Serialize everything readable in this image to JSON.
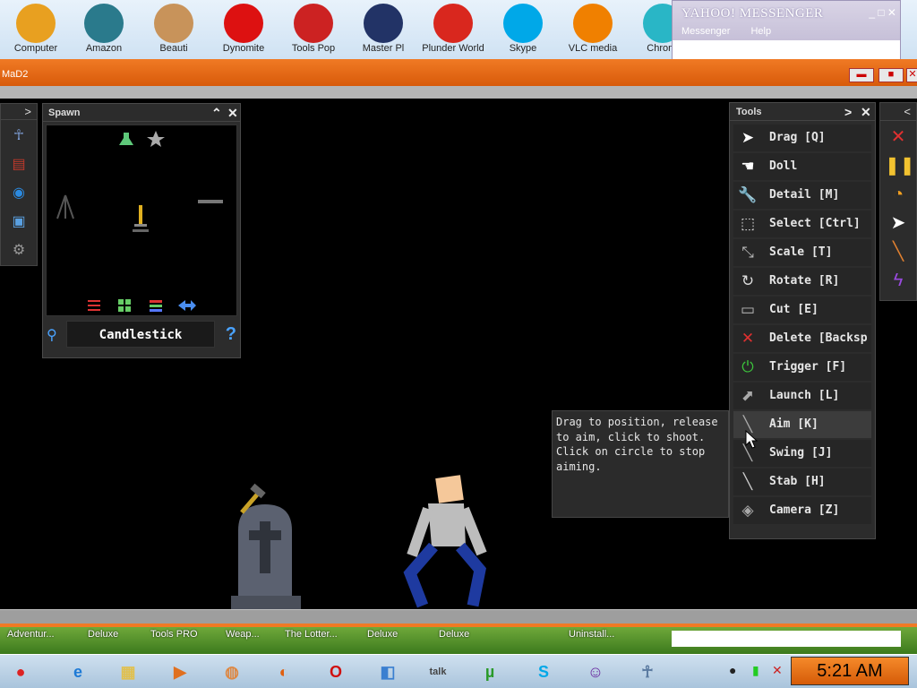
{
  "desktop": {
    "icons": [
      {
        "label": "Computer",
        "icon": "computer-icon",
        "color": "#e8a020"
      },
      {
        "label": "Amazon",
        "icon": "amazon-compass-icon",
        "color": "#2a7a8c"
      },
      {
        "label": "Beauti",
        "icon": "beauty-face-icon",
        "color": "#c8935a"
      },
      {
        "label": "Dynomite",
        "icon": "dynomite-ball-icon",
        "color": "#d11"
      },
      {
        "label": "Tools Pop",
        "icon": "tools-pop-bird-icon",
        "color": "#c22"
      },
      {
        "label": "Master Pl",
        "icon": "master-pl-shield-icon",
        "color": "#223366"
      },
      {
        "label": "Plunder World",
        "icon": "plunder-p-icon",
        "color": "#d9271e"
      },
      {
        "label": "Skype",
        "icon": "skype-icon",
        "color": "#00a8e8"
      },
      {
        "label": "VLC media",
        "icon": "vlc-cone-icon",
        "color": "#f08000"
      },
      {
        "label": "Chromi",
        "icon": "chromium-icon",
        "color": "#29b6c6"
      }
    ]
  },
  "yahoo": {
    "title": "YAHOO! MESSENGER",
    "menu": [
      "Messenger",
      "Help"
    ],
    "controls": "_ □ ✕"
  },
  "app": {
    "title": "MaD2",
    "minimize": "▬",
    "maximize": "■",
    "close": "✕"
  },
  "left_bar": {
    "expand": ">",
    "items": [
      {
        "icon": "ragdoll-icon",
        "glyph": "☥",
        "color": "#7fa0d8"
      },
      {
        "icon": "book-icon",
        "glyph": "▤",
        "color": "#c0392b"
      },
      {
        "icon": "globe-icon",
        "glyph": "◉",
        "color": "#2b8ae0"
      },
      {
        "icon": "save-disk-icon",
        "glyph": "▣",
        "color": "#5aa0e0"
      },
      {
        "icon": "settings-gear-icon",
        "glyph": "⚙",
        "color": "#999"
      }
    ]
  },
  "spawn": {
    "title": "Spawn",
    "collapse": "⌃",
    "close": "✕",
    "search_value": "Candlestick",
    "help": "?"
  },
  "tools": {
    "title": "Tools",
    "expand": ">",
    "close": "✕",
    "items": [
      {
        "label": "Drag [Q]",
        "icon": "drag-cursor-icon",
        "glyph": "➤",
        "color": "#fff"
      },
      {
        "label": "Doll",
        "icon": "doll-hand-icon",
        "glyph": "☚",
        "color": "#fff"
      },
      {
        "label": "Detail [M]",
        "icon": "wrench-icon",
        "glyph": "🔧",
        "color": "#aaa"
      },
      {
        "label": "Select [Ctrl]",
        "icon": "select-box-icon",
        "glyph": "⬚",
        "color": "#ddd"
      },
      {
        "label": "Scale [T]",
        "icon": "scale-icon",
        "glyph": "⤡",
        "color": "#bbb"
      },
      {
        "label": "Rotate [R]",
        "icon": "rotate-icon",
        "glyph": "↻",
        "color": "#ddd"
      },
      {
        "label": "Cut [E]",
        "icon": "cut-icon",
        "glyph": "▭",
        "color": "#bbb"
      },
      {
        "label": "Delete [Backsp",
        "icon": "delete-x-icon",
        "glyph": "✕",
        "color": "#e03030"
      },
      {
        "label": "Trigger [F]",
        "icon": "power-icon",
        "glyph": "⏻",
        "color": "#3cc43c"
      },
      {
        "label": "Launch [L]",
        "icon": "launch-icon",
        "glyph": "⬈",
        "color": "#aaa"
      },
      {
        "label": "Aim [K]",
        "icon": "aim-gun-icon",
        "glyph": "╲",
        "color": "#aaa"
      },
      {
        "label": "Swing [J]",
        "icon": "swing-hammer-icon",
        "glyph": "╲",
        "color": "#aaa"
      },
      {
        "label": "Stab [H]",
        "icon": "stab-knife-icon",
        "glyph": "╲",
        "color": "#ccc"
      },
      {
        "label": "Camera [Z]",
        "icon": "camera-icon",
        "glyph": "◈",
        "color": "#aaa"
      }
    ],
    "active_index": 10
  },
  "right_bar": {
    "collapse": "<",
    "items": [
      {
        "icon": "clear-x-icon",
        "glyph": "✕",
        "color": "#e03030"
      },
      {
        "icon": "pause-icon",
        "glyph": "❚❚",
        "color": "#f2c230"
      },
      {
        "icon": "stopwatch-icon",
        "glyph": "◔",
        "color": "#f2a020"
      },
      {
        "icon": "pointer-icon",
        "glyph": "➤",
        "color": "#fff"
      },
      {
        "icon": "knife-icon",
        "glyph": "╲",
        "color": "#e08030"
      },
      {
        "icon": "lightning-icon",
        "glyph": "ϟ",
        "color": "#9a4ae0"
      }
    ]
  },
  "tooltip": {
    "text": "Drag to position, release to aim, click to shoot. Click on circle to stop aiming."
  },
  "quickbar": {
    "items": [
      "Adventur...",
      "Deluxe",
      "Tools PRO",
      "Weap...",
      "The Lotter...",
      "Deluxe",
      "Deluxe",
      "Uninstall..."
    ]
  },
  "taskbar": {
    "items": [
      {
        "icon": "angry-birds-icon",
        "glyph": "●",
        "color": "#d22"
      },
      {
        "icon": "internet-explorer-icon",
        "glyph": "e",
        "color": "#1e7ad6"
      },
      {
        "icon": "folder-icon",
        "glyph": "▦",
        "color": "#e0c050"
      },
      {
        "icon": "media-player-icon",
        "glyph": "▶",
        "color": "#e07020"
      },
      {
        "icon": "chrome-icon",
        "glyph": "◍",
        "color": "#d84"
      },
      {
        "icon": "firefox-icon",
        "glyph": "◐",
        "color": "#e06010"
      },
      {
        "icon": "opera-icon",
        "glyph": "O",
        "color": "#d01010"
      },
      {
        "icon": "cube-app-icon",
        "glyph": "◧",
        "color": "#3a7fd0"
      },
      {
        "icon": "google-talk-icon",
        "glyph": "talk",
        "color": "#444"
      },
      {
        "icon": "utorrent-icon",
        "glyph": "µ",
        "color": "#2a9a2a"
      },
      {
        "icon": "skype-icon",
        "glyph": "S",
        "color": "#00a8e8"
      },
      {
        "icon": "yahoo-messenger-icon",
        "glyph": "☺",
        "color": "#6a2aa0"
      },
      {
        "icon": "game-figure-icon",
        "glyph": "☥",
        "color": "#5a7aa0"
      }
    ],
    "clock": "5:21 AM"
  }
}
